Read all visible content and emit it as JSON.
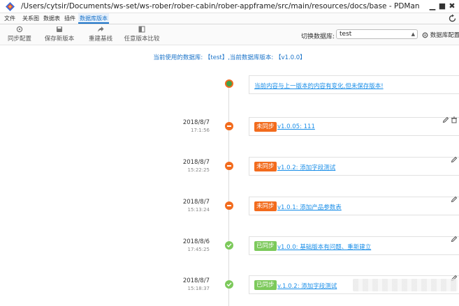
{
  "window": {
    "title": "/Users/cytsir/Documents/ws-set/ws-rober/rober-cabin/rober-appframe/src/main/resources/docs/base - PDMan",
    "controls": {
      "minimize": "▁",
      "maximize": "■",
      "close": "✖"
    }
  },
  "menu": {
    "items": [
      "文件",
      "关系图",
      "数据表",
      "插件",
      "数据库版本"
    ],
    "active": "数据库版本"
  },
  "toolbar": {
    "sync_config": "同步配置",
    "save_version": "保存新版本",
    "rebuild_baseline": "重建基线",
    "compare_any": "任意版本比较",
    "switch_db_label": "切换数据库:",
    "db_selected": "test",
    "db_config": "数据库配置"
  },
  "current_info": "当前使用的数据库: 【test】,当前数据库版本: 【v1.0.0】",
  "current_entry": {
    "message": "当前内容与上一版本的内容有变化,但未保存版本!"
  },
  "entries": [
    {
      "date": "2018/8/7",
      "time": "17:1:56",
      "status": "未同步",
      "synced": false,
      "link": "v1.0.05: 111",
      "deletable": true
    },
    {
      "date": "2018/8/7",
      "time": "15:22:25",
      "status": "未同步",
      "synced": false,
      "link": "v1.0.2: 添加字段测试",
      "deletable": false
    },
    {
      "date": "2018/8/7",
      "time": "15:13:24",
      "status": "未同步",
      "synced": false,
      "link": "v1.0.1: 添加产品参数表",
      "deletable": false
    },
    {
      "date": "2018/8/6",
      "time": "17:45:25",
      "status": "已同步",
      "synced": true,
      "link": "v1.0.0: 基础版本有问题、重新建立",
      "deletable": false
    },
    {
      "date": "2018/8/7",
      "time": "15:18:37",
      "status": "已同步",
      "synced": true,
      "link": "v.1.0.2: 添加字段测试",
      "deletable": false
    }
  ],
  "colors": {
    "accent": "#1a73c9",
    "link": "#1a8ee8",
    "unsynced": "#f26b1d",
    "synced": "#7cc95b"
  }
}
